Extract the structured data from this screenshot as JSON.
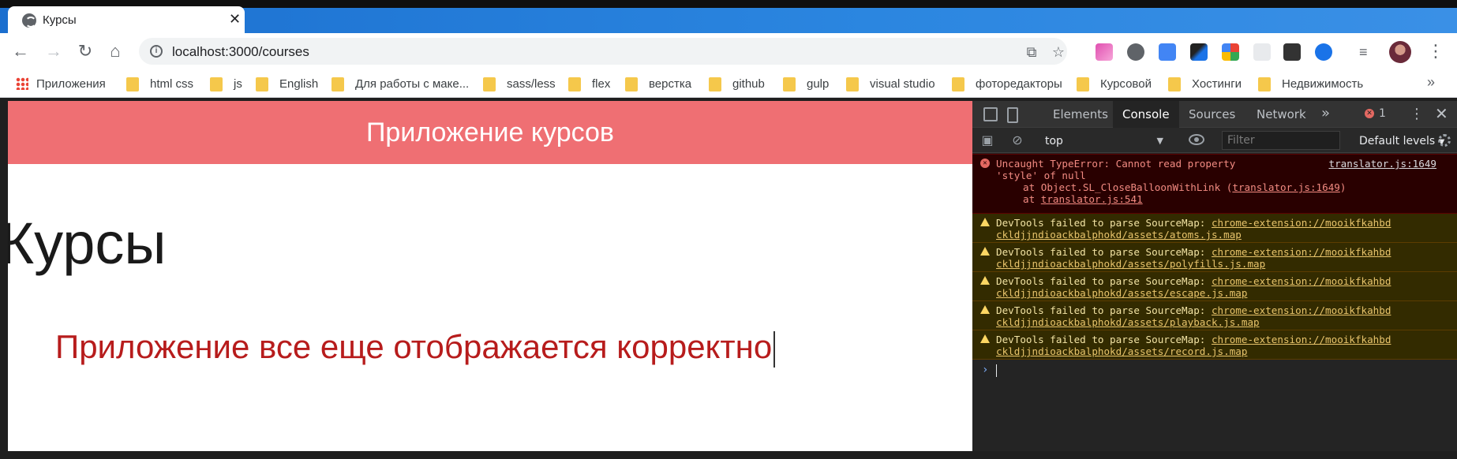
{
  "browser": {
    "tab_title": "Курсы",
    "url": "localhost:3000/courses",
    "bookmarks": [
      {
        "label": "Приложения",
        "icon": "apps-grid-icon"
      },
      {
        "label": "html css",
        "icon": "folder-icon"
      },
      {
        "label": "js",
        "icon": "folder-icon"
      },
      {
        "label": "English",
        "icon": "folder-icon"
      },
      {
        "label": "Для работы с маке...",
        "icon": "folder-icon"
      },
      {
        "label": "sass/less",
        "icon": "folder-icon"
      },
      {
        "label": "flex",
        "icon": "folder-icon"
      },
      {
        "label": "верстка",
        "icon": "folder-icon"
      },
      {
        "label": "github",
        "icon": "folder-icon"
      },
      {
        "label": "gulp",
        "icon": "folder-icon"
      },
      {
        "label": "visual studio",
        "icon": "folder-icon"
      },
      {
        "label": "фоторедакторы",
        "icon": "folder-icon"
      },
      {
        "label": "Курсовой",
        "icon": "folder-icon"
      },
      {
        "label": "Хостинги",
        "icon": "folder-icon"
      },
      {
        "label": "Недвижимость",
        "icon": "folder-icon"
      }
    ],
    "more_bookmarks": "»"
  },
  "page": {
    "header_title": "Приложение курсов",
    "heading": "Курсы",
    "message": "Приложение все еще отображается корректно"
  },
  "devtools": {
    "tabs": [
      "Elements",
      "Console",
      "Sources",
      "Network"
    ],
    "active_tab": "Console",
    "more_tabs": "»",
    "error_count": "1",
    "context": "top",
    "filter_placeholder": "Filter",
    "levels": "Default levels",
    "error": {
      "line1": "Uncaught TypeError: Cannot read property",
      "line2": "'style' of null",
      "source": "translator.js:1649",
      "stack1_prefix": "at Object.SL_CloseBalloonWithLink (",
      "stack1_link": "translator.js:1649",
      "stack1_suffix": ")",
      "stack2_prefix": "at ",
      "stack2_link": "translator.js:541"
    },
    "warnings": [
      {
        "prefix": "DevTools failed to parse SourceMap: ",
        "link1": "chrome-extension://mooikfkahbd",
        "link2": "ckldjjndioackbalphokd/assets/atoms.js.map"
      },
      {
        "prefix": "DevTools failed to parse SourceMap: ",
        "link1": "chrome-extension://mooikfkahbd",
        "link2": "ckldjjndioackbalphokd/assets/polyfills.js.map"
      },
      {
        "prefix": "DevTools failed to parse SourceMap: ",
        "link1": "chrome-extension://mooikfkahbd",
        "link2": "ckldjjndioackbalphokd/assets/escape.js.map"
      },
      {
        "prefix": "DevTools failed to parse SourceMap: ",
        "link1": "chrome-extension://mooikfkahbd",
        "link2": "ckldjjndioackbalphokd/assets/playback.js.map"
      },
      {
        "prefix": "DevTools failed to parse SourceMap: ",
        "link1": "chrome-extension://mooikfkahbd",
        "link2": "ckldjjndioackbalphokd/assets/record.js.map"
      }
    ]
  },
  "colors": {
    "header_bg": "#ef6f73",
    "message_text": "#b71c1c",
    "titlebar_blue": "#2b86e0"
  }
}
